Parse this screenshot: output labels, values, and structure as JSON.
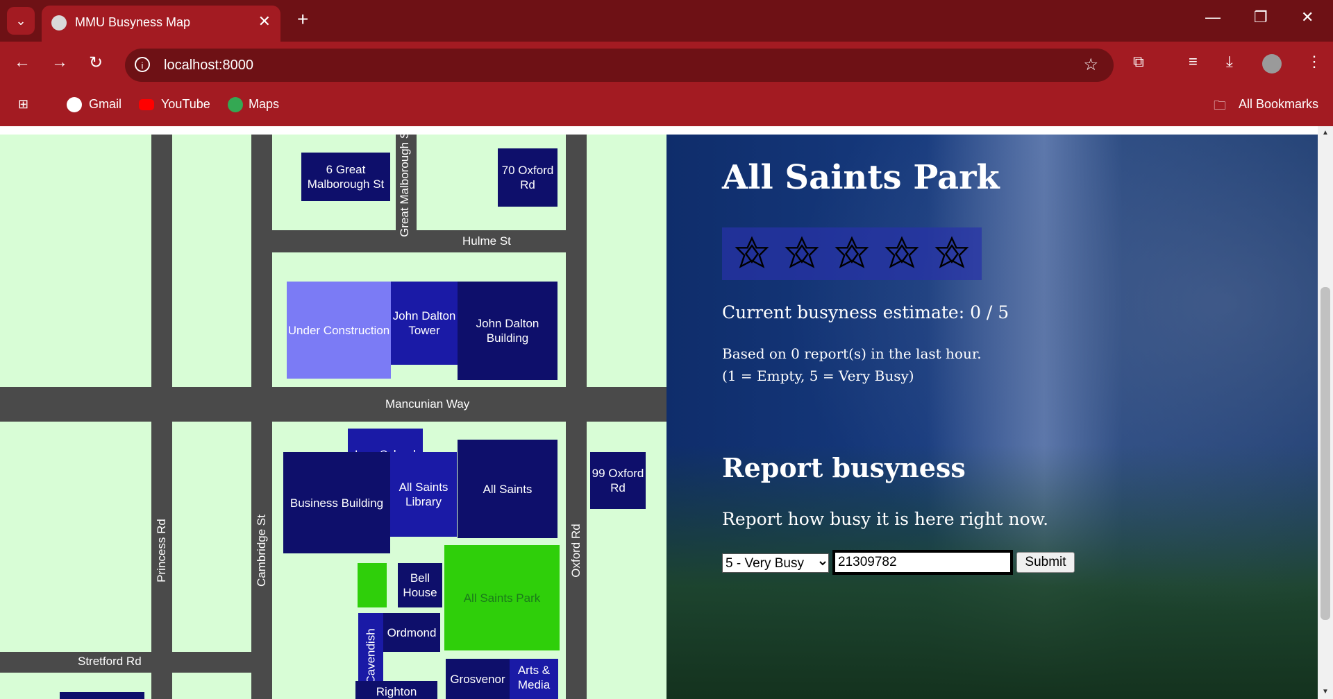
{
  "browser": {
    "tab_title": "MMU Busyness Map",
    "url": "localhost:8000",
    "bookmarks": [
      "Gmail",
      "YouTube",
      "Maps"
    ],
    "all_bookmarks": "All Bookmarks"
  },
  "map": {
    "roads": {
      "hulme": "Hulme St",
      "great_malborough": "Great Malborough St",
      "mancunian": "Mancunian Way",
      "princess": "Princess Rd",
      "cambridge": "Cambridge St",
      "oxford": "Oxford Rd",
      "stretford": "Stretford Rd"
    },
    "buildings": {
      "b6_great_malborough": "6 Great Malborough St",
      "b70_oxford": "70 Oxford Rd",
      "under_construction": "Under Construction",
      "john_dalton_tower": "John Dalton Tower",
      "john_dalton_building": "John Dalton Building",
      "law_school": "Law School",
      "business_building": "Business Building",
      "all_saints_library": "All Saints Library",
      "all_saints": "All Saints",
      "b99_oxford": "99 Oxford Rd",
      "bell_house": "Bell House",
      "all_saints_park": "All Saints Park",
      "ordmond": "Ordmond",
      "cavendish": "Cavendish",
      "grosvenor": "Grosvenor",
      "arts_media": "Arts & Media",
      "righton": "Righton"
    }
  },
  "panel": {
    "title": "All Saints Park",
    "rating_max": 5,
    "rating_value": 0,
    "estimate": "Current busyness estimate: 0 / 5",
    "reports": "Based on 0 report(s) in the last hour.",
    "scale": "(1 = Empty, 5 = Very Busy)",
    "report_heading": "Report busyness",
    "report_prompt": "Report how busy it is here right now.",
    "select_value": "5 - Very Busy",
    "input_value": "21309782",
    "submit_label": "Submit"
  }
}
